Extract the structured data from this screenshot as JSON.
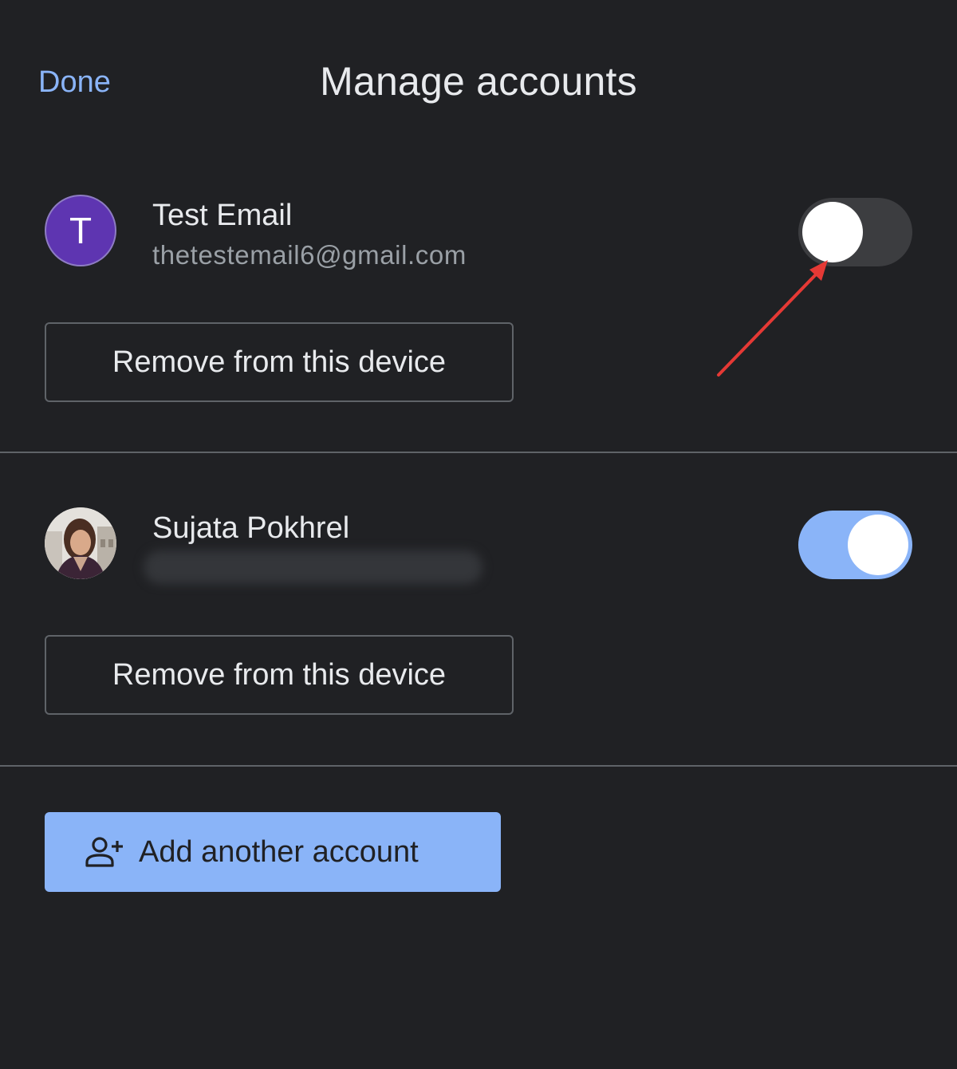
{
  "header": {
    "done_label": "Done",
    "title": "Manage accounts"
  },
  "accounts": [
    {
      "avatar_letter": "T",
      "name": "Test Email",
      "email": "thetestemail6@gmail.com",
      "toggle_on": false,
      "remove_label": "Remove from this device"
    },
    {
      "avatar_icon": "profile-photo",
      "name": "Sujata Pokhrel",
      "email_state": "blurred",
      "toggle_on": true,
      "remove_label": "Remove from this device"
    }
  ],
  "add_account": {
    "icon": "add-person-icon",
    "label": "Add another account"
  },
  "colors": {
    "background": "#202124",
    "accent": "#8ab4f8",
    "avatar_purple": "#5e35b1",
    "annotation_arrow": "#e53935"
  }
}
